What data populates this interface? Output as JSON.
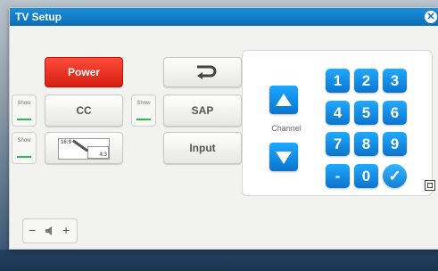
{
  "window": {
    "title": "TV Setup",
    "close_glyph": "✕"
  },
  "buttons": {
    "power": "Power",
    "cc": "CC",
    "sap": "SAP",
    "input": "Input"
  },
  "show_label": "Show",
  "aspect_icon": {
    "from": "16:9",
    "to": "4:3"
  },
  "channel": {
    "label": "Channel",
    "keys": [
      "1",
      "2",
      "3",
      "4",
      "5",
      "6",
      "7",
      "8",
      "9",
      "-",
      "0"
    ],
    "check_glyph": "✓"
  },
  "volume": {
    "minus": "−",
    "plus": "+",
    "speaker_icon": "speaker-icon"
  },
  "colors": {
    "accent": "#0d6db7",
    "power": "#e02a1a",
    "indicator": "#28c04a"
  }
}
